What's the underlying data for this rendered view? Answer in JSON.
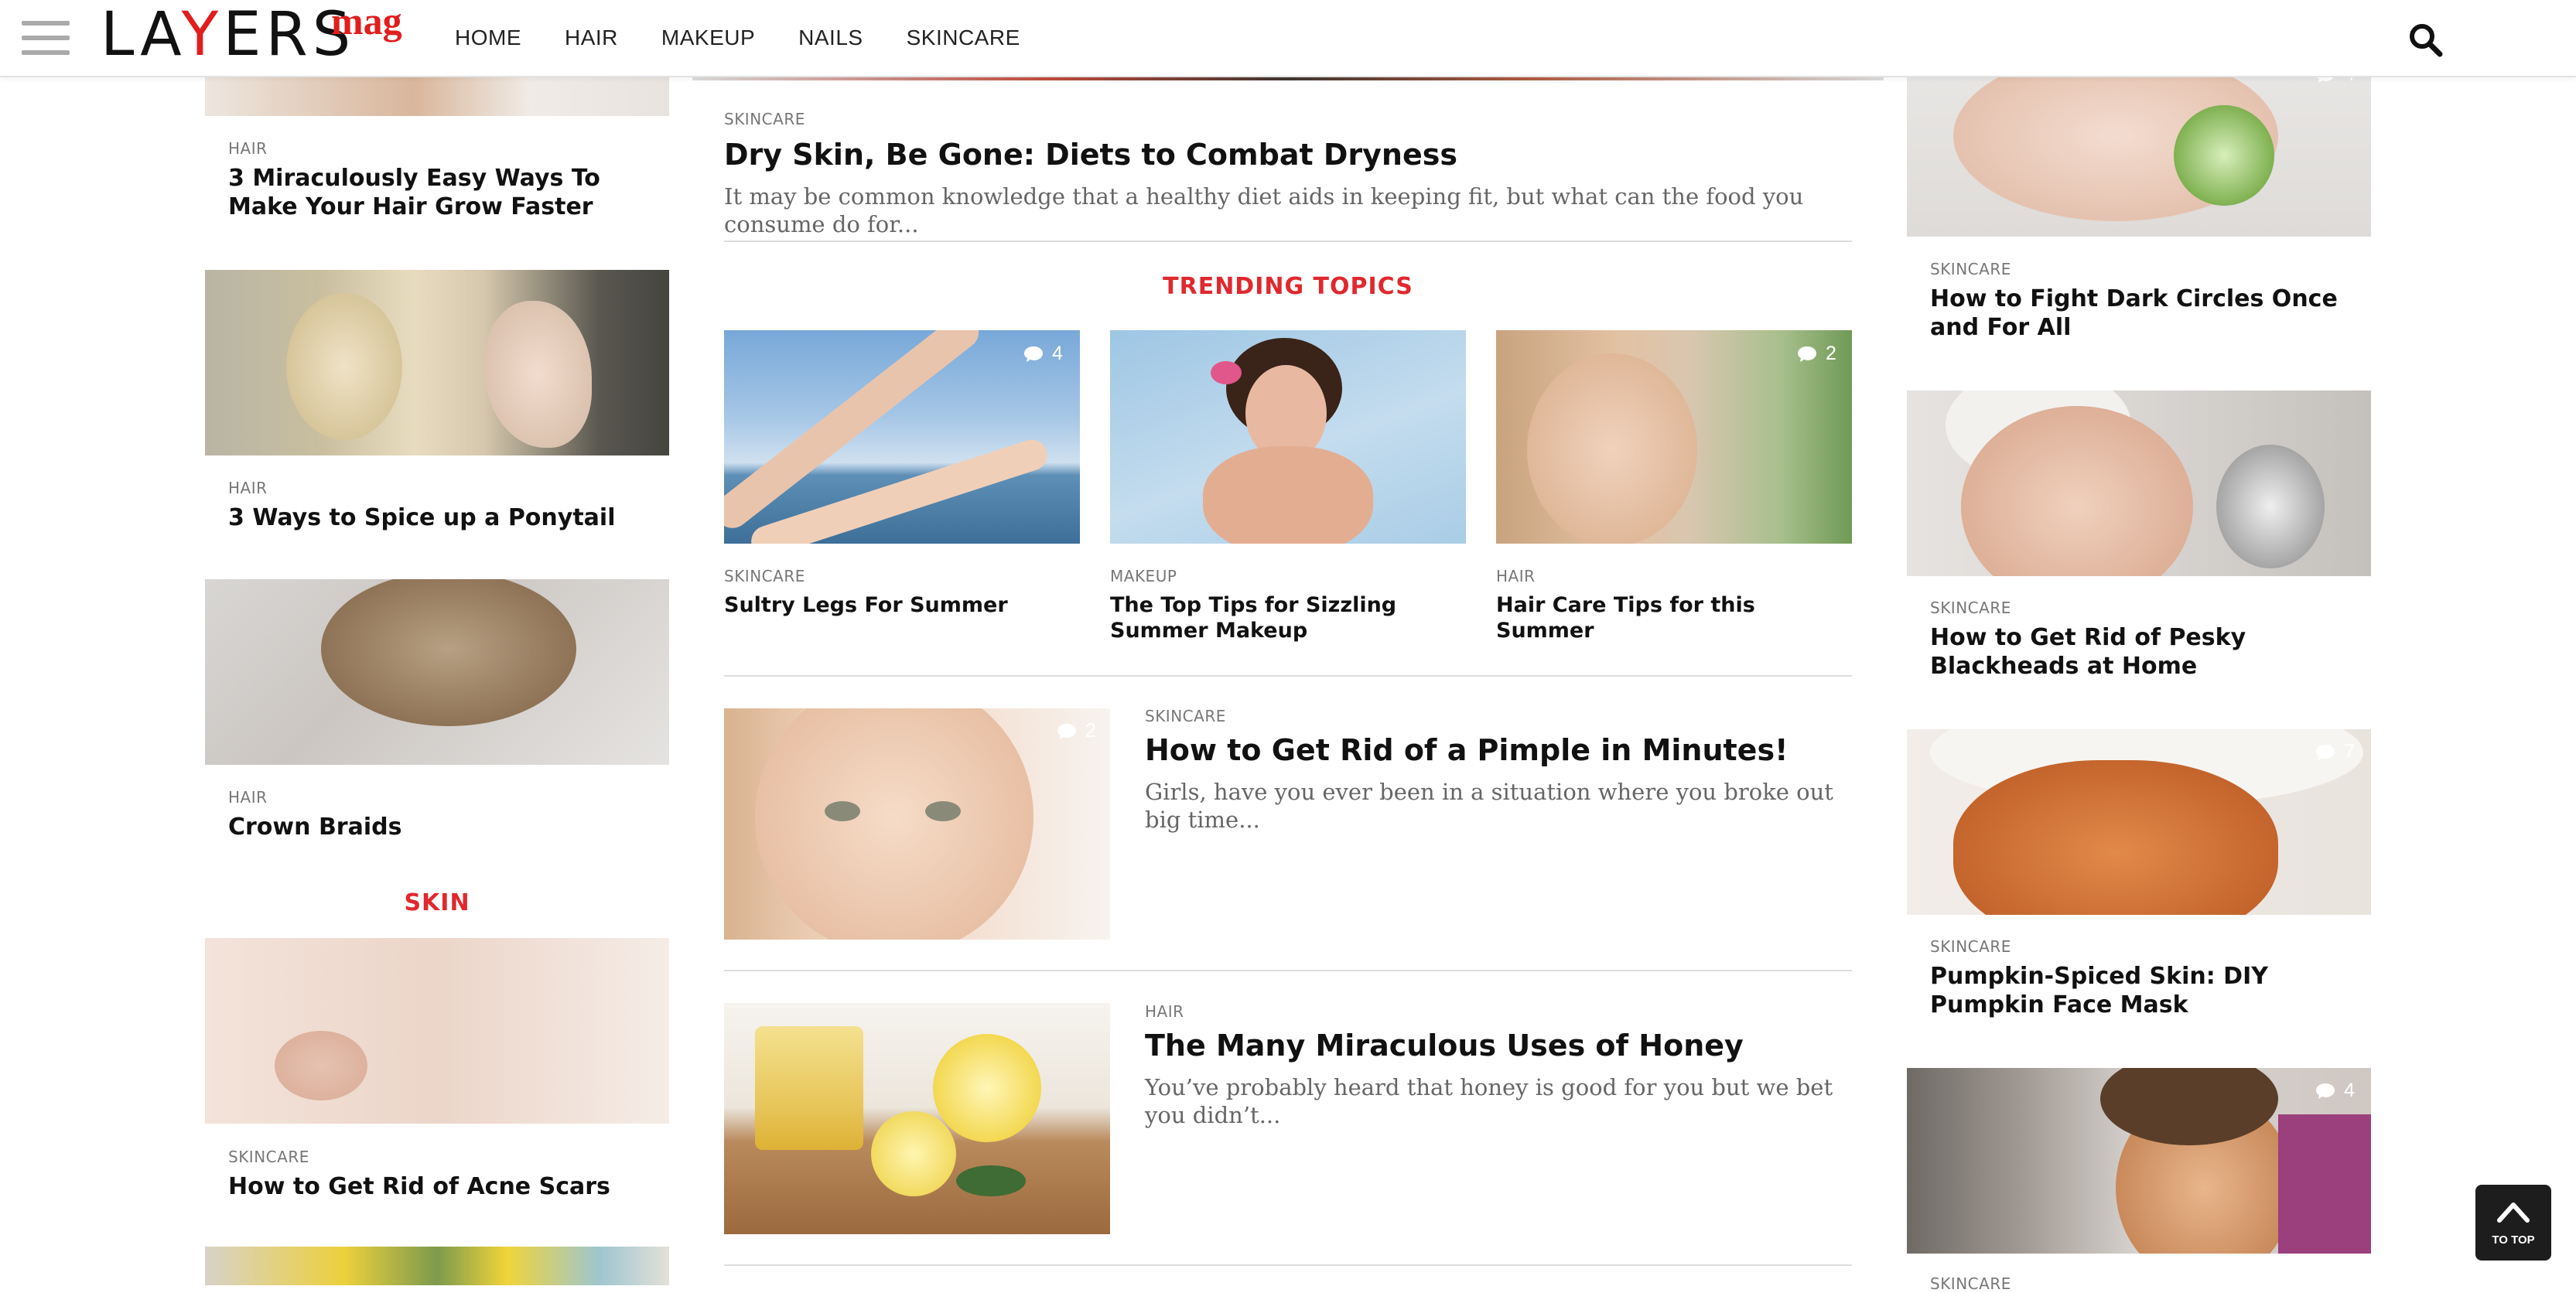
{
  "header": {
    "logo_main": "LAYERS",
    "logo_accent": "mag",
    "nav": [
      "HOME",
      "HAIR",
      "MAKEUP",
      "NAILS",
      "SKINCARE"
    ],
    "menu_icon": "hamburger-menu-icon",
    "search_icon": "search-icon"
  },
  "left": {
    "items": [
      {
        "category": "HAIR",
        "title": "3 Miraculously Easy Ways To Make Your Hair Grow Faster"
      },
      {
        "category": "HAIR",
        "title": "3 Ways to Spice up a Ponytail"
      },
      {
        "category": "HAIR",
        "title": "Crown Braids"
      }
    ],
    "skin_heading": "SKIN",
    "skin_items": [
      {
        "category": "SKINCARE",
        "title": "How to Get Rid of Acne Scars"
      }
    ]
  },
  "main": {
    "top_article": {
      "category": "SKINCARE",
      "title": "Dry Skin, Be Gone: Diets to Combat Dryness",
      "excerpt": "It may be common knowledge that a healthy diet aids in keeping fit, but what can the food you consume do for..."
    },
    "trending_heading": "TRENDING TOPICS",
    "trending": [
      {
        "category": "SKINCARE",
        "title": "Sultry Legs For Summer",
        "comments": "4"
      },
      {
        "category": "MAKEUP",
        "title": "The Top Tips for Sizzling Summer Makeup",
        "comments": ""
      },
      {
        "category": "HAIR",
        "title": "Hair Care Tips for this Summer",
        "comments": "2"
      }
    ],
    "list": [
      {
        "category": "SKINCARE",
        "title": "How to Get Rid of a Pimple in Minutes!",
        "excerpt": "Girls, have you ever been in a situation where you broke out big time...",
        "comments": "2"
      },
      {
        "category": "HAIR",
        "title": "The Many Miraculous Uses of Honey",
        "excerpt": "You’ve probably heard that honey is good for you but we bet you didn’t...",
        "comments": ""
      }
    ]
  },
  "right": {
    "items": [
      {
        "category": "SKINCARE",
        "title": "How to Fight Dark Circles Once and For All",
        "comments": "4"
      },
      {
        "category": "SKINCARE",
        "title": "How to Get Rid of Pesky Blackheads at Home",
        "comments": ""
      },
      {
        "category": "SKINCARE",
        "title": "Pumpkin-Spiced Skin: DIY Pumpkin Face Mask",
        "comments": "7"
      },
      {
        "category": "SKINCARE",
        "title": "",
        "comments": "4"
      }
    ]
  },
  "totop_label": "TO TOP",
  "colors": {
    "accent": "#e0282e",
    "text": "#111111",
    "meta": "#777777",
    "excerpt": "#666666"
  }
}
